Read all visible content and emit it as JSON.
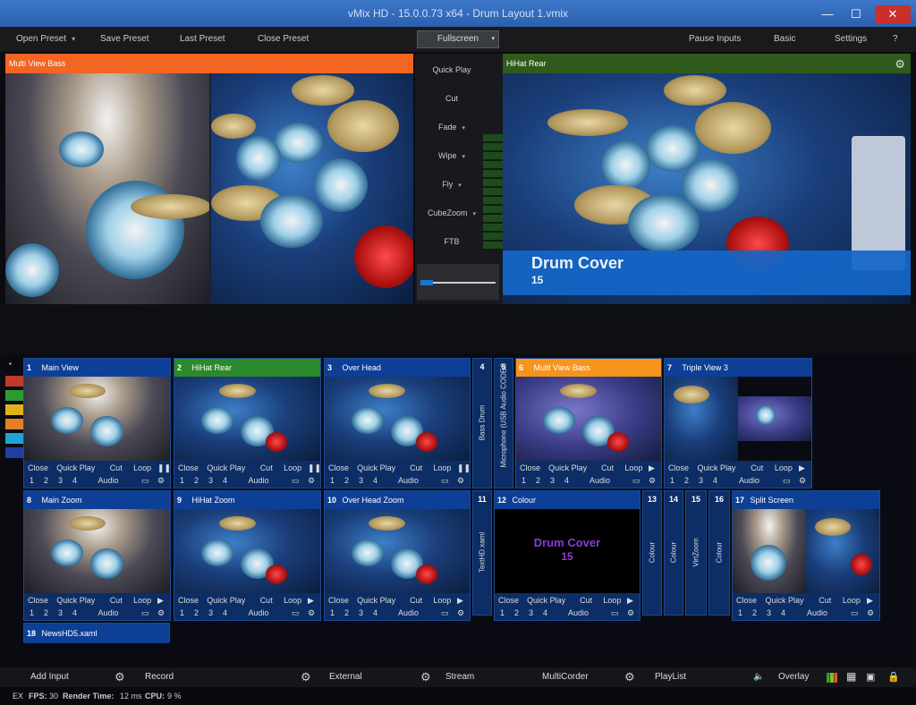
{
  "window": {
    "title": "vMix HD - 15.0.0.73 x64 - Drum Layout 1.vmix"
  },
  "menu": {
    "open_preset": "Open Preset",
    "save_preset": "Save Preset",
    "last_preset": "Last Preset",
    "close_preset": "Close Preset",
    "fullscreen": "Fullscreen",
    "pause_inputs": "Pause Inputs",
    "basic": "Basic",
    "settings": "Settings",
    "help": "?"
  },
  "preview": {
    "label": "Multi View Bass",
    "label_color": "#f26522"
  },
  "transitions": [
    "Quick Play",
    "Cut",
    "Fade",
    "Wipe",
    "Fly",
    "CubeZoom",
    "FTB"
  ],
  "program": {
    "label": "HiHat Rear",
    "label_color": "#2f5a1b",
    "overlay_title": "Drum Cover",
    "overlay_subtitle": "15"
  },
  "inputs_row1": [
    {
      "num": "1",
      "name": "Main View",
      "hdr": "#0d3f96",
      "play": "Close",
      "qp": "Quick Play",
      "cut": "Cut",
      "loop": "Loop",
      "btn": "❚❚",
      "b1": "1",
      "b2": "2",
      "b3": "3",
      "b4": "4",
      "audio": "Audio"
    },
    {
      "num": "2",
      "name": "HiHat Rear",
      "hdr": "#2c8a2c",
      "play": "Close",
      "qp": "Quick Play",
      "cut": "Cut",
      "loop": "Loop",
      "btn": "❚❚",
      "b1": "1",
      "b2": "2",
      "b3": "3",
      "b4": "4",
      "audio": "Audio"
    },
    {
      "num": "3",
      "name": "Over Head",
      "hdr": "#0d3f96",
      "play": "Close",
      "qp": "Quick Play",
      "cut": "Cut",
      "loop": "Loop",
      "btn": "❚❚",
      "b1": "1",
      "b2": "2",
      "b3": "3",
      "b4": "4",
      "audio": "Audio"
    },
    {
      "num": "6",
      "name": "Multi View Bass",
      "hdr": "#f7941d",
      "play": "Close",
      "qp": "Quick Play",
      "cut": "Cut",
      "loop": "Loop",
      "btn": "▶",
      "b1": "1",
      "b2": "2",
      "b3": "3",
      "b4": "4",
      "audio": "Audio"
    },
    {
      "num": "7",
      "name": "Triple View 3",
      "hdr": "#0d3f96",
      "play": "Close",
      "qp": "Quick Play",
      "cut": "Cut",
      "loop": "Loop",
      "btn": "▶",
      "b1": "1",
      "b2": "2",
      "b3": "3",
      "b4": "4",
      "audio": "Audio"
    }
  ],
  "narrow_row1": [
    {
      "num": "4",
      "name": "Bass Drum"
    },
    {
      "num": "5",
      "name": "Microphone (USB Audio CODEC"
    }
  ],
  "inputs_row2": [
    {
      "num": "8",
      "name": "Main Zoom",
      "play": "Close",
      "qp": "Quick Play",
      "cut": "Cut",
      "loop": "Loop",
      "btn": "▶",
      "b1": "1",
      "b2": "2",
      "b3": "3",
      "b4": "4",
      "audio": "Audio"
    },
    {
      "num": "9",
      "name": "HiHat Zoom",
      "play": "Close",
      "qp": "Quick Play",
      "cut": "Cut",
      "loop": "Loop",
      "btn": "▶",
      "b1": "1",
      "b2": "2",
      "b3": "3",
      "b4": "4",
      "audio": "Audio"
    },
    {
      "num": "10",
      "name": "Over Head Zoom",
      "play": "Close",
      "qp": "Quick Play",
      "cut": "Cut",
      "loop": "Loop",
      "btn": "▶",
      "b1": "1",
      "b2": "2",
      "b3": "3",
      "b4": "4",
      "audio": "Audio"
    },
    {
      "num": "12",
      "name": "Colour",
      "play": "Close",
      "qp": "Quick Play",
      "cut": "Cut",
      "loop": "Loop",
      "btn": "▶",
      "b1": "1",
      "b2": "2",
      "b3": "3",
      "b4": "4",
      "audio": "Audio",
      "thumb_title": "Drum Cover",
      "thumb_sub": "15"
    },
    {
      "num": "17",
      "name": "Split Screen",
      "play": "Close",
      "qp": "Quick Play",
      "cut": "Cut",
      "loop": "Loop",
      "btn": "▶",
      "b1": "1",
      "b2": "2",
      "b3": "3",
      "b4": "4",
      "audio": "Audio"
    }
  ],
  "narrow_row2": [
    {
      "num": "11",
      "name": "TextHD.xaml"
    },
    {
      "num": "13",
      "name": "Colour"
    },
    {
      "num": "14",
      "name": "Colour"
    },
    {
      "num": "15",
      "name": "VirtZoom"
    },
    {
      "num": "16",
      "name": "Colour"
    }
  ],
  "input18": {
    "num": "18",
    "name": "NewsHD5.xaml"
  },
  "strip_colors": [
    "#c0392b",
    "#2e9b2e",
    "#e1b21a",
    "#e67e22",
    "#1fa3d6",
    "#1f3f9f"
  ],
  "bottom": {
    "add_input": "Add Input",
    "record": "Record",
    "external": "External",
    "stream": "Stream",
    "multicorder": "MultiCorder",
    "playlist": "PlayList",
    "overlay": "Overlay"
  },
  "status": {
    "ex": "EX",
    "fps_label": "FPS:",
    "fps": "30",
    "render_label": "Render Time:",
    "render": "12 ms",
    "cpu_label": "CPU:",
    "cpu": "9 %"
  }
}
